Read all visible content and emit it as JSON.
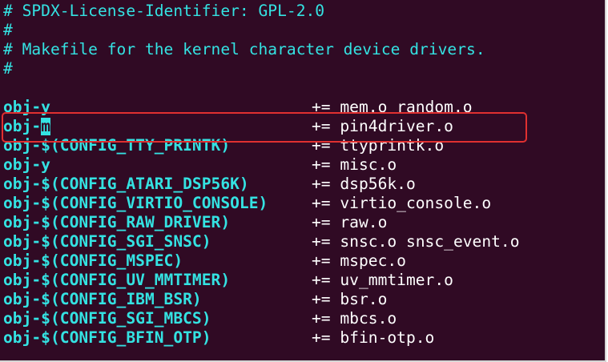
{
  "comments": [
    "# SPDX-License-Identifier: GPL-2.0",
    "#",
    "# Makefile for the kernel character device drivers.",
    "#"
  ],
  "lines": [
    {
      "lhs": "obj-y",
      "op": "+= mem.o random.o"
    },
    {
      "lhs_prefix": "obj-",
      "cursor_char": "m",
      "op": "+= pin4driver.o"
    },
    {
      "lhs": "obj-$(CONFIG_TTY_PRINTK)",
      "op": "+= ttyprintk.o"
    },
    {
      "lhs": "obj-y",
      "op": "+= misc.o"
    },
    {
      "lhs": "obj-$(CONFIG_ATARI_DSP56K)",
      "op": "+= dsp56k.o"
    },
    {
      "lhs": "obj-$(CONFIG_VIRTIO_CONSOLE)",
      "op": "+= virtio_console.o"
    },
    {
      "lhs": "obj-$(CONFIG_RAW_DRIVER)",
      "op": "+= raw.o"
    },
    {
      "lhs": "obj-$(CONFIG_SGI_SNSC)",
      "op": "+= snsc.o snsc_event.o"
    },
    {
      "lhs": "obj-$(CONFIG_MSPEC)",
      "op": "+= mspec.o"
    },
    {
      "lhs": "obj-$(CONFIG_UV_MMTIMER)",
      "op": "+= uv_mmtimer.o"
    },
    {
      "lhs": "obj-$(CONFIG_IBM_BSR)",
      "op": "+= bsr.o"
    },
    {
      "lhs": "obj-$(CONFIG_SGI_MBCS)",
      "op": "+= mbcs.o"
    },
    {
      "lhs": "obj-$(CONFIG_BFIN_OTP)",
      "op": "+= bfin-otp.o"
    }
  ],
  "colors": {
    "background": "#300a24",
    "keyword": "#34e2e2",
    "text": "#ffffff",
    "highlight_box": "#e03030"
  }
}
